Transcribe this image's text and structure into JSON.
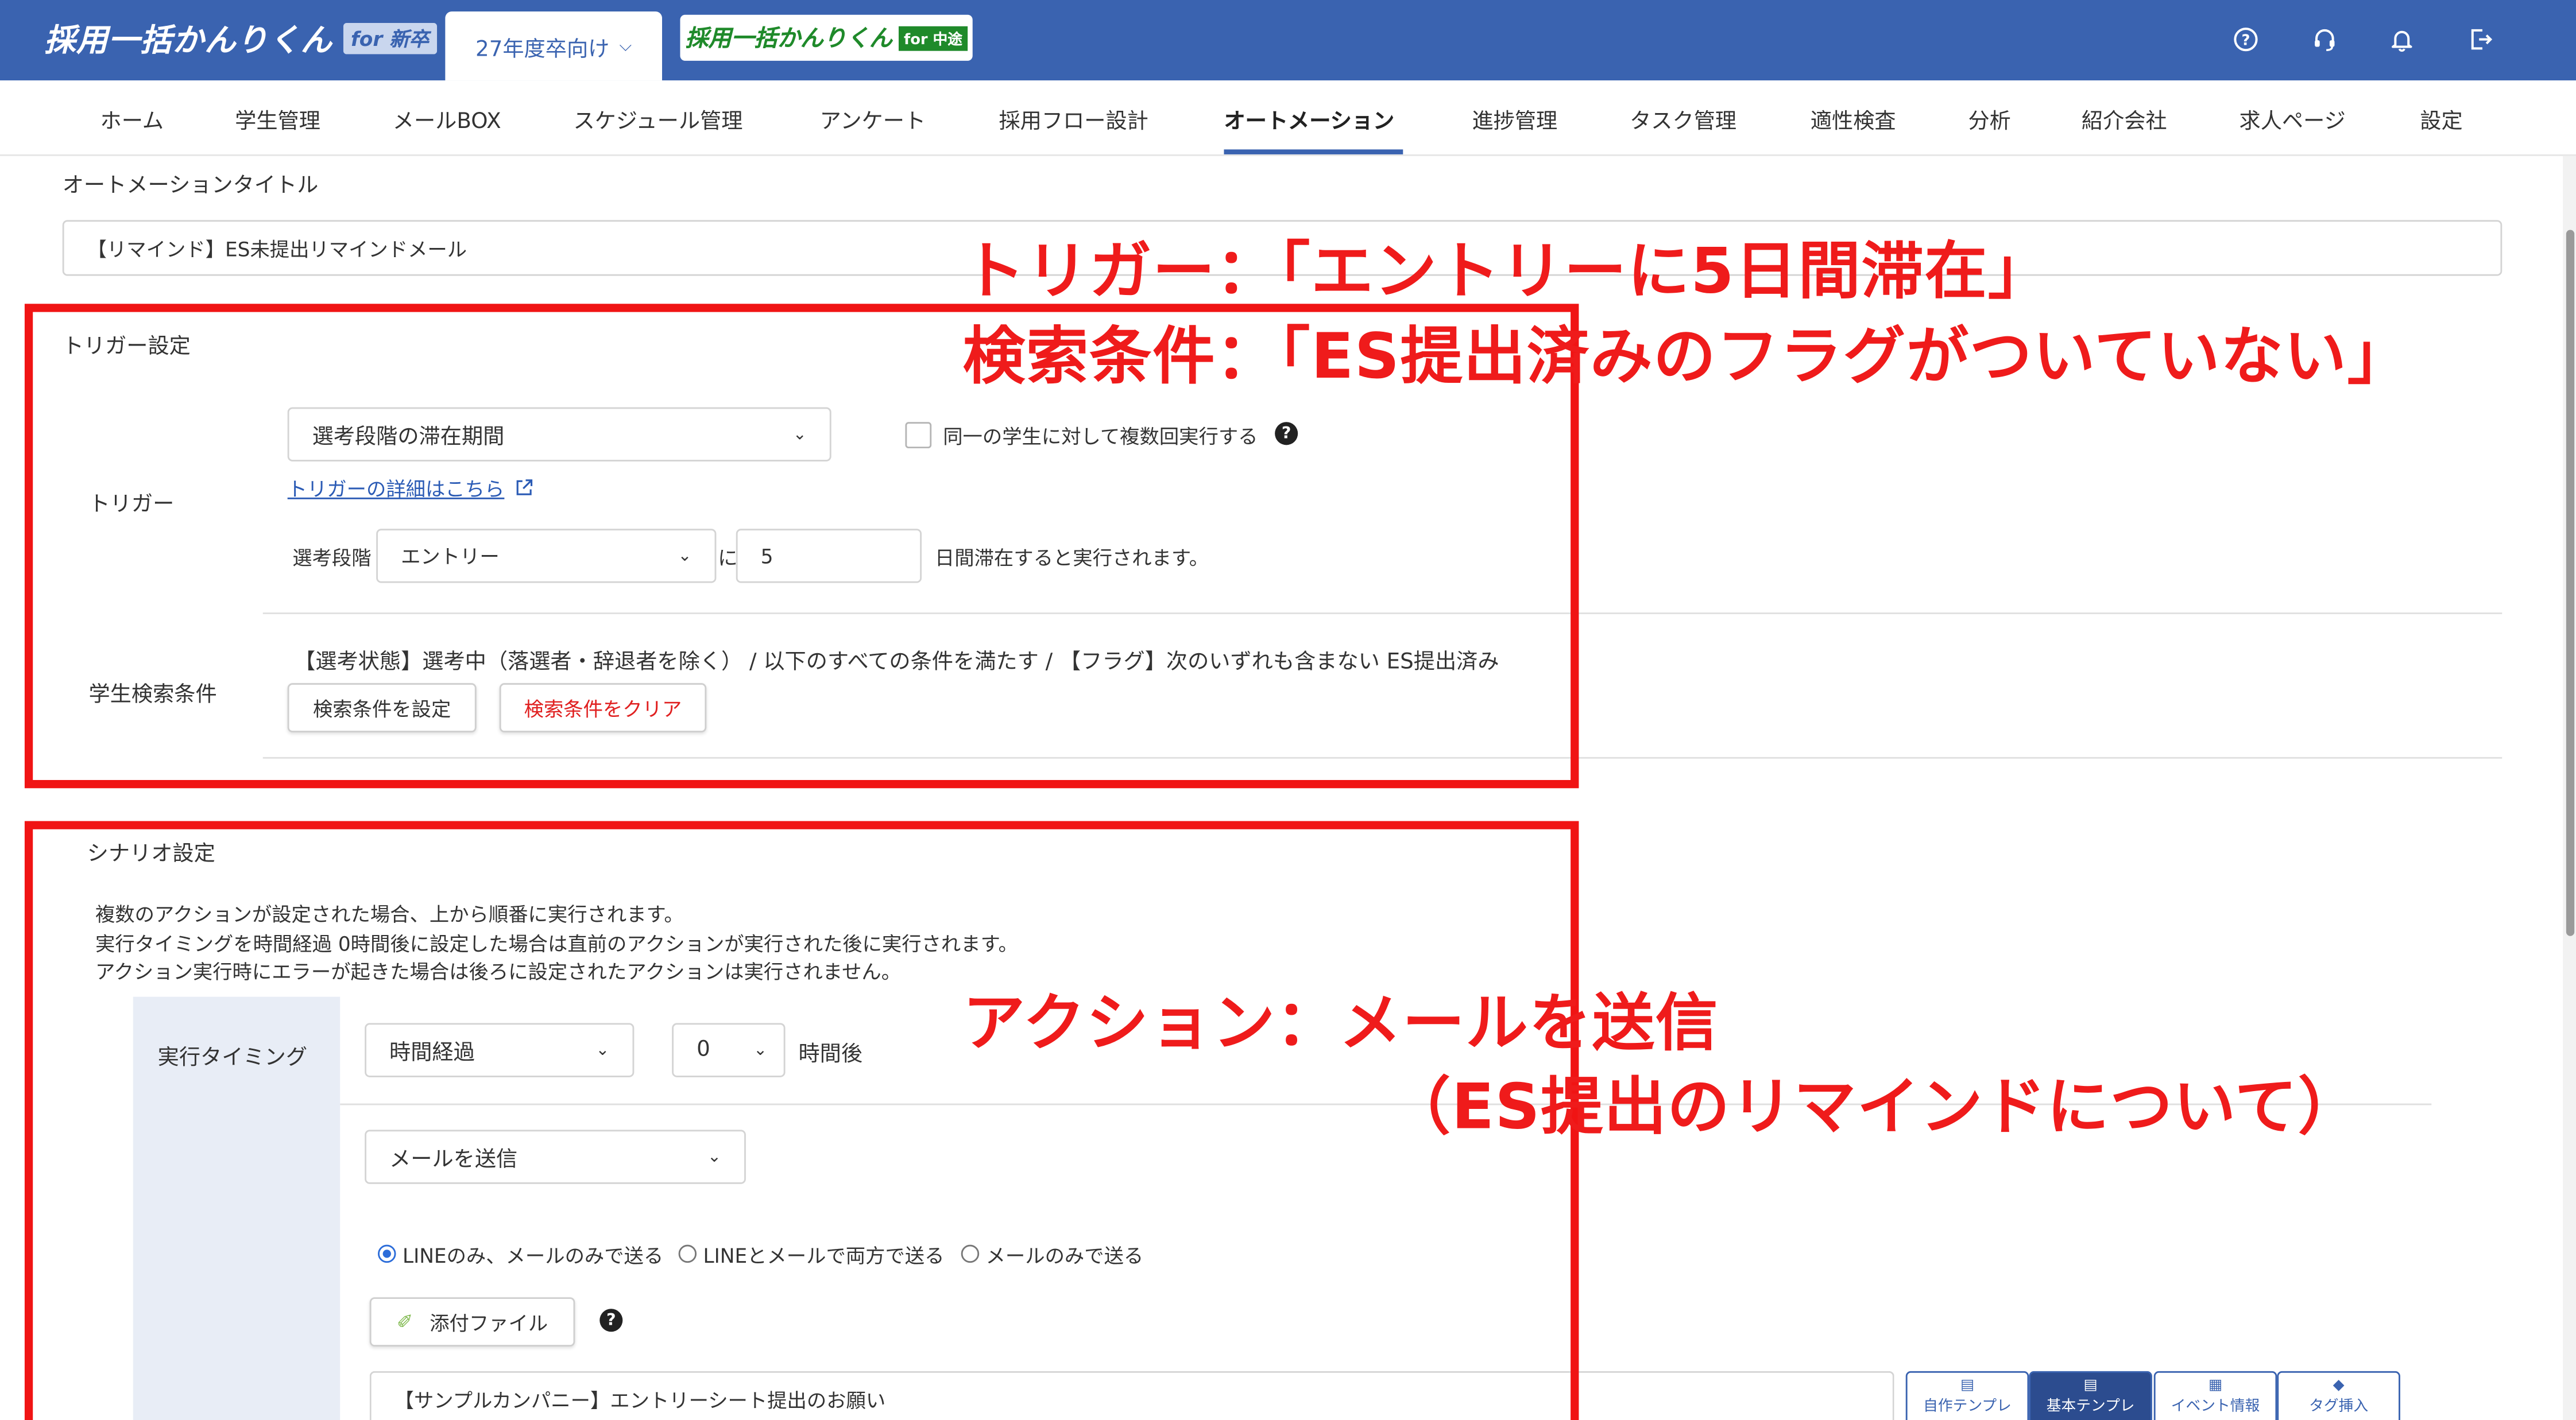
{
  "header": {
    "brand_main": "採用一括かんりくん",
    "brand_sub": "for 新卒",
    "year_selector": "27年度卒向け",
    "mid_brand_main": "採用一括かんりくん",
    "mid_brand_sub": "for 中途",
    "icons": [
      "help-circle-icon",
      "headset-icon",
      "bell-icon",
      "logout-icon"
    ]
  },
  "nav": {
    "items": [
      "ホーム",
      "学生管理",
      "メールBOX",
      "スケジュール管理",
      "アンケート",
      "採用フロー設計",
      "オートメーション",
      "進捗管理",
      "タスク管理",
      "適性検査",
      "分析",
      "紹介会社",
      "求人ページ",
      "設定"
    ],
    "active": "オートメーション"
  },
  "form": {
    "title_label": "オートメーションタイトル",
    "title_value": "【リマインド】ES未提出リマインドメール",
    "trigger_section": "トリガー設定",
    "trigger_label": "トリガー",
    "trigger_select": "選考段階の滞在期間",
    "multi_exec_label": "同一の学生に対して複数回実行する",
    "trigger_detail_link": "トリガーの詳細はこちら",
    "stage_label": "選考段階",
    "stage_select": "エントリー",
    "ni": "に",
    "days_value": "5",
    "days_suffix": "日間滞在すると実行されます。",
    "search_label": "学生検索条件",
    "search_condition_text": "【選考状態】選考中（落選者・辞退者を除く） / 以下のすべての条件を満たす / 【フラグ】次のいずれも含まない ES提出済み",
    "set_condition_btn": "検索条件を設定",
    "clear_condition_btn": "検索条件をクリア",
    "scenario_section": "シナリオ設定",
    "scenario_notes": [
      "複数のアクションが設定された場合、上から順番に実行されます。",
      "実行タイミングを時間経過 0時間後に設定した場合は直前のアクションが実行された後に実行されます。",
      "アクション実行時にエラーが起きた場合は後ろに設定されたアクションは実行されません。"
    ],
    "timing_label": "実行タイミング",
    "timing_select": "時間経過",
    "hours_select": "0",
    "hours_suffix": "時間後",
    "action_select": "メールを送信",
    "send_options": [
      "LINEのみ、メールのみで送る",
      "LINEとメールで両方で送る",
      "メールのみで送る"
    ],
    "selected_send_option": 0,
    "attach_btn": "添付ファイル",
    "subject_value": "【サンプルカンパニー】エントリーシート提出のお願い",
    "template_buttons": [
      "自作テンプレ",
      "基本テンプレ",
      "イベント情報",
      "タグ挿入"
    ]
  },
  "annotations": {
    "trigger_note": "トリガー：「エントリーに5日間滞在」",
    "search_note": "検索条件：「ES提出済みのフラグがついていない」",
    "action_note": "アクション：メールを送信",
    "action_note_sub": "（ES提出のリマインドについて）",
    "annotation_color": "#f01414"
  },
  "colors": {
    "header_bg": "#3a63b0",
    "link": "#2b5bb5",
    "danger_text": "#e02020"
  }
}
